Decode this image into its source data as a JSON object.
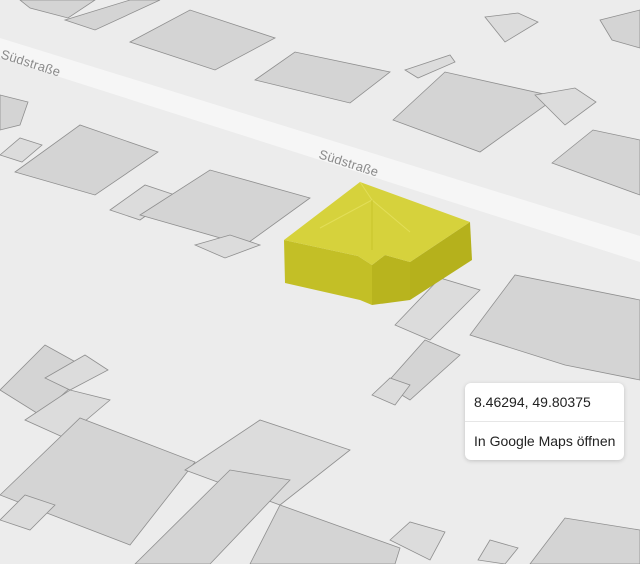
{
  "map": {
    "street_labels": [
      "Südstraße",
      "Südstraße"
    ],
    "colors": {
      "ground": "#ececec",
      "road": "#f6f6f6",
      "building_top": "#d4d4d4",
      "building_edge": "#8f8f8f",
      "building_shadow": "#c9c9c9",
      "highlight_top": "#d6d23c",
      "highlight_side": "#b8b41e",
      "highlight_front": "#c8c42a"
    }
  },
  "popup": {
    "coordinates": "8.46294, 49.80375",
    "link_label": "In Google Maps öffnen"
  }
}
